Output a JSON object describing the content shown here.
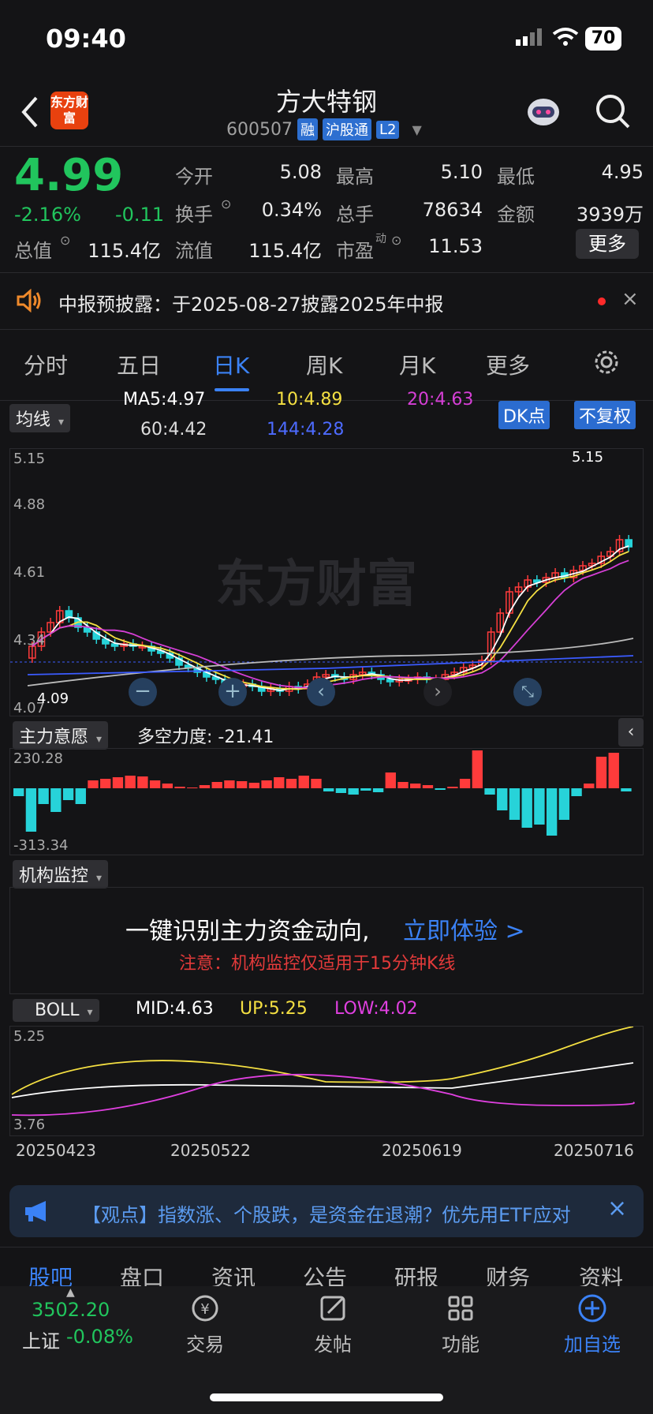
{
  "status": {
    "time": "09:40",
    "battery": "70"
  },
  "header": {
    "logo_text": "东方财富",
    "title": "方大特钢",
    "code": "600507",
    "tags": [
      "融",
      "沪股通",
      "L2"
    ]
  },
  "quote": {
    "price": "4.99",
    "change_pct": "-2.16%",
    "change": "-0.11",
    "open_label": "今开",
    "open": "5.08",
    "high_label": "最高",
    "high": "5.10",
    "low_label": "最低",
    "low": "4.95",
    "turnover_label": "换手",
    "turnover": "0.34%",
    "volume_label": "总手",
    "volume": "78634",
    "amount_label": "金额",
    "amount": "3939万",
    "mcap_label": "总值",
    "mcap": "115.4亿",
    "float_label": "流值",
    "float": "115.4亿",
    "pe_label": "市盈",
    "pe_sup": "动",
    "pe": "11.53",
    "more": "更多"
  },
  "notice": {
    "text": "中报预披露：于2025-08-27披露2025年中报"
  },
  "tabs": [
    "分时",
    "五日",
    "日K",
    "周K",
    "月K",
    "更多"
  ],
  "active_tab": "日K",
  "ma": {
    "selector": "均线",
    "ma5": "MA5:4.97",
    "ma10": "10:4.89",
    "ma20": "20:4.63",
    "ma60": "60:4.42",
    "ma144": "144:4.28",
    "dk_button": "DK点",
    "adj_button": "不复权",
    "colors": {
      "ma5": "#ffffff",
      "ma10": "#f5e042",
      "ma20": "#d63fd6",
      "ma60": "#c8c8c8",
      "ma144": "#3b5bff"
    }
  },
  "main_chart": {
    "y_ticks": [
      "5.15",
      "4.88",
      "4.61",
      "4.34",
      "4.07"
    ],
    "high_marker": "5.15",
    "low_marker": "4.09",
    "watermark": "东方财富"
  },
  "indicator1": {
    "selector": "主力意愿",
    "label": "多空力度: -21.41",
    "top": "230.28",
    "bottom": "-313.34"
  },
  "indicator2": {
    "selector": "机构监控",
    "headline": "一键识别主力资金动向,",
    "link": "立即体验 >",
    "note": "注意：机构监控仅适用于15分钟K线"
  },
  "boll": {
    "selector": "BOLL",
    "mid": "MID:4.63",
    "up": "UP:5.25",
    "low": "LOW:4.02",
    "top": "5.25",
    "bottom": "3.76",
    "dates": [
      "20250423",
      "20250522",
      "20250619",
      "20250716"
    ]
  },
  "banner": {
    "text": "【观点】指数涨、个股跌，是资金在退潮？优先用ETF应对"
  },
  "bottom_tabs": [
    "股吧",
    "盘口",
    "资讯",
    "公告",
    "研报",
    "财务",
    "资料"
  ],
  "index": {
    "value": "3502.20",
    "name": "上证",
    "change": "-0.08%"
  },
  "nav": [
    {
      "label": "交易",
      "icon": "trade-icon"
    },
    {
      "label": "发帖",
      "icon": "post-icon"
    },
    {
      "label": "功能",
      "icon": "apps-icon"
    },
    {
      "label": "加自选",
      "icon": "add-icon"
    }
  ]
}
